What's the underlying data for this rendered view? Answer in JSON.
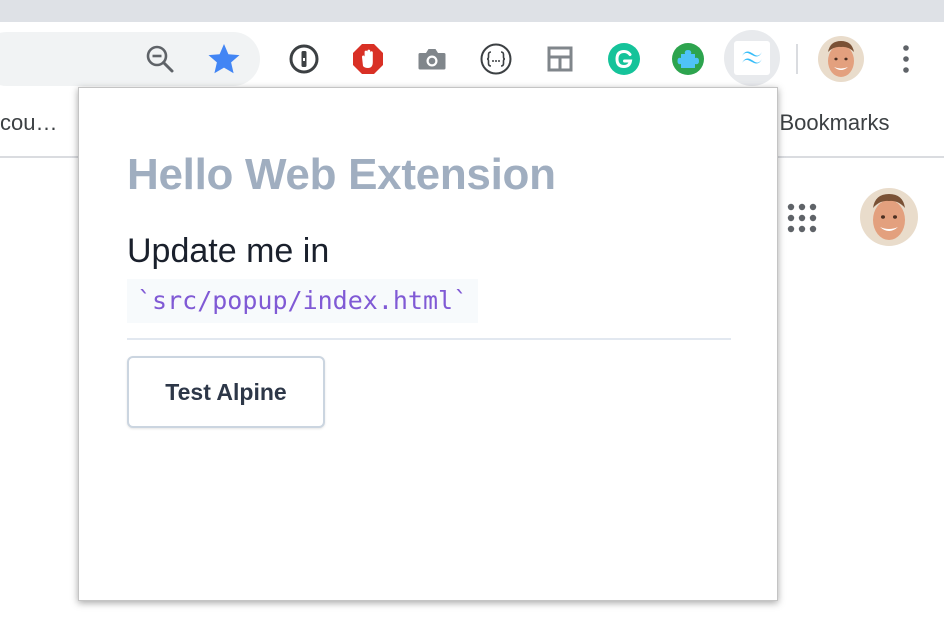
{
  "browser": {
    "toolbar_icons": [
      "zoom-out-icon",
      "bookmark-star-icon",
      "onepassword-icon",
      "adblock-icon",
      "camera-icon",
      "json-viewer-icon",
      "layout-icon",
      "grammarly-icon",
      "puzzle-extension-icon",
      "tailwind-extension-icon",
      "kebab-menu-icon"
    ],
    "accent_colors": {
      "star": "#4285f4",
      "adblock": "#d93025",
      "grammarly": "#15c39a",
      "puzzle": "#2da44e",
      "tailwind": "#38bdf8"
    }
  },
  "bookmarks_bar": {
    "left_item": "cou…",
    "right_item": "r Bookmarks"
  },
  "popup": {
    "title": "Hello Web Extension",
    "text": "Update me in",
    "code": "`src/popup/index.html`",
    "button_label": "Test Alpine",
    "colors": {
      "title": "#a0aec0",
      "code": "#805ad5"
    }
  }
}
